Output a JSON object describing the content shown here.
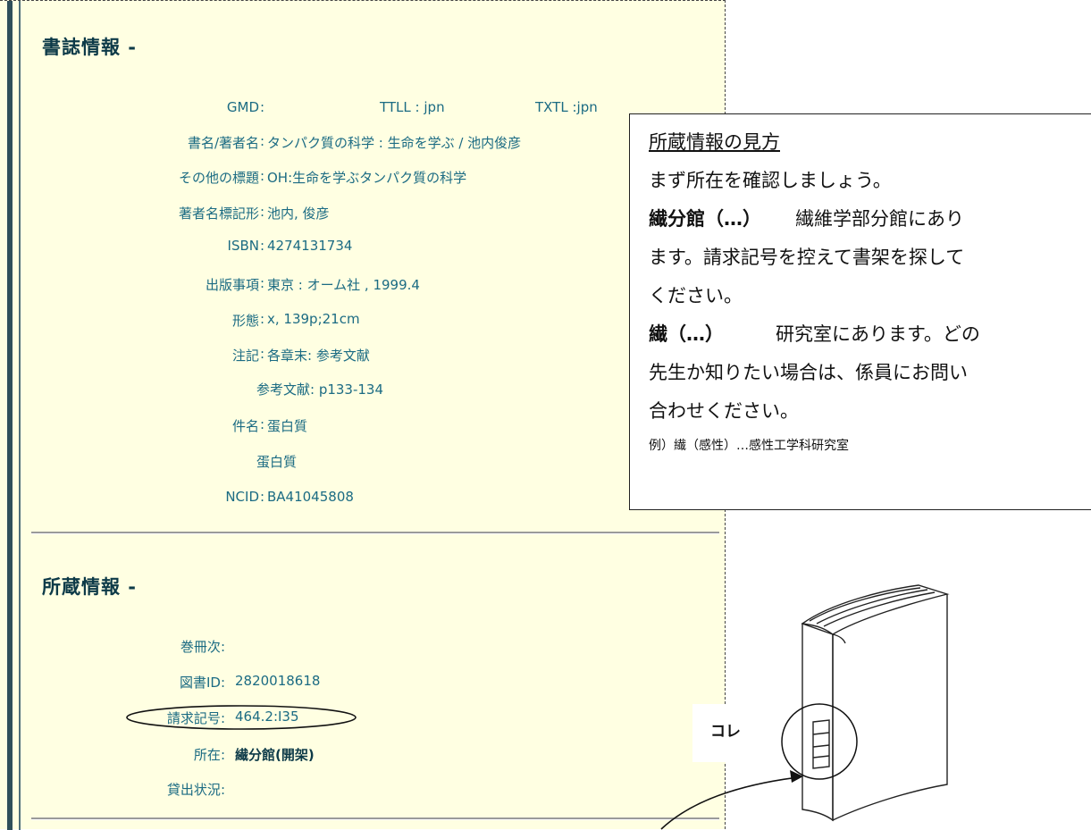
{
  "bib": {
    "title": "書誌情報 -",
    "gmd_label": "GMD",
    "ttll_label": "TTLL",
    "ttll_value": "jpn",
    "txtl_label": "TXTL",
    "txtl_value": "jpn",
    "fields": [
      {
        "label": "書名/著者名",
        "value": "タンパク質の科学 : 生命を学ぶ / 池内俊彦"
      },
      {
        "label": "その他の標題",
        "value": "OH:生命を学ぶタンパク質の科学"
      },
      {
        "label": "著者名標記形",
        "value": "池内, 俊彦"
      },
      {
        "label": "ISBN",
        "value": "4274131734"
      },
      {
        "label": "出版事項",
        "value": "東京 : オーム社 , 1999.4"
      },
      {
        "label": "形態",
        "value": "x, 139p;21cm"
      },
      {
        "label": "注記",
        "value": "各章末: 参考文献"
      },
      {
        "label": "",
        "value": "参考文献: p133-134"
      },
      {
        "label": "件名",
        "value": "蛋白質"
      },
      {
        "label": "",
        "value": "蛋白質"
      },
      {
        "label": "NCID",
        "value": "BA41045808"
      }
    ]
  },
  "holding": {
    "title": "所蔵情報 -",
    "fields": [
      {
        "label": "巻冊次",
        "value": ""
      },
      {
        "label": "図書ID",
        "value": "2820018618"
      },
      {
        "label": "請求記号",
        "value": "464.2:I35"
      },
      {
        "label": "所在",
        "value": "繊分館(開架)"
      },
      {
        "label": "貸出状況",
        "value": ""
      }
    ]
  },
  "callout": {
    "title": "所蔵情報の見方",
    "intro": "まず所在を確認しましょう。",
    "item1_head": "繊分館（…）",
    "item1_text": "繊維学部分館にあり",
    "item1_text2": "ます。請求記号を控えて書架を探して",
    "item1_text3": "ください。",
    "item2_head": "繊（…）",
    "item2_text": "研究室にあります。どの",
    "item2_text2": "先生か知りたい場合は、係員にお問い",
    "item2_text3": "合わせください。",
    "example": "例）繊（感性）…感性工学科研究室"
  },
  "illustration": {
    "pointer_label": "コレ"
  }
}
